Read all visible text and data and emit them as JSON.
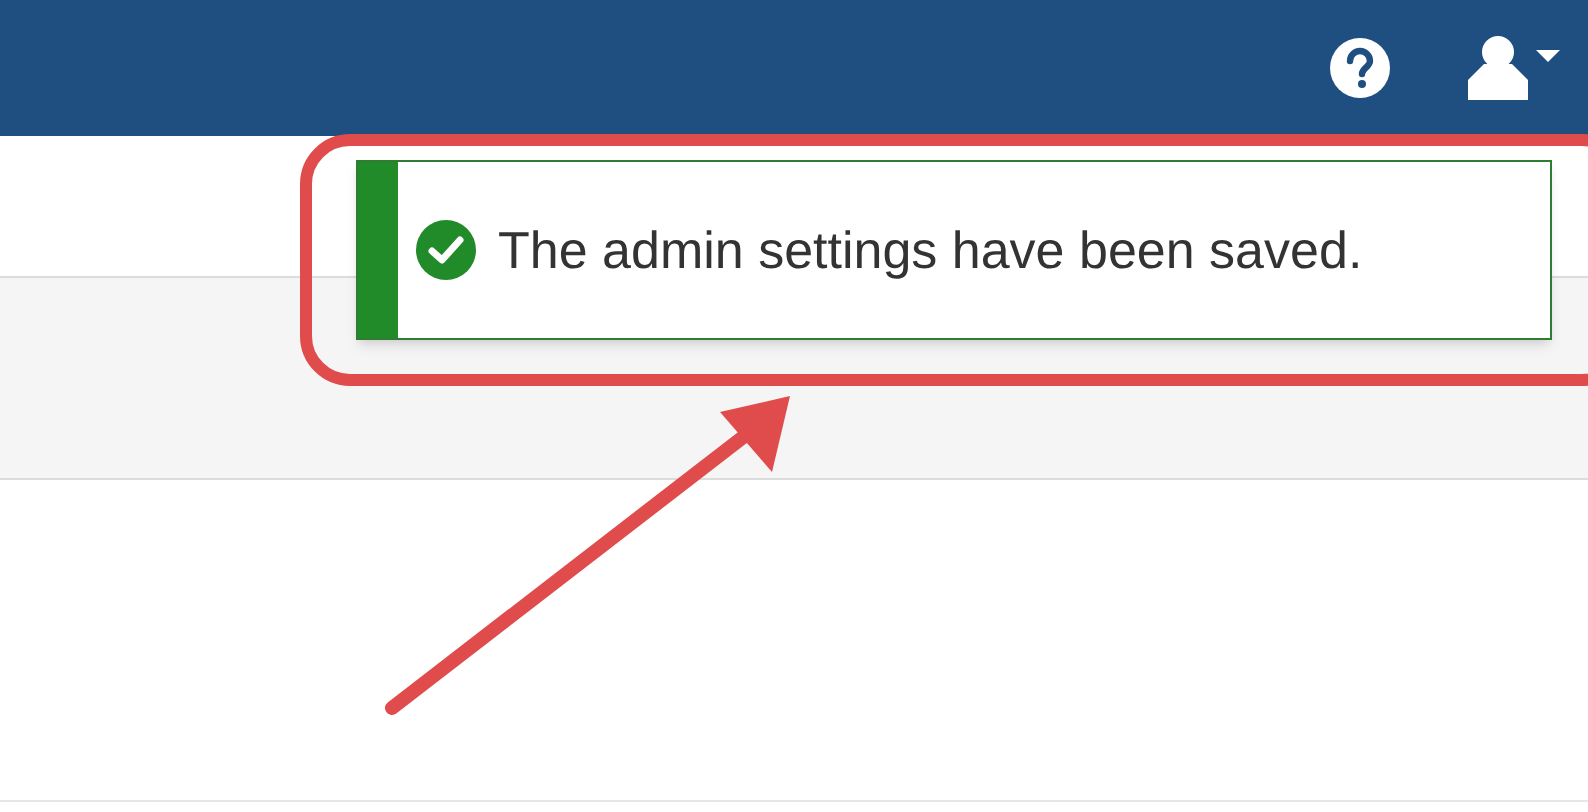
{
  "notification": {
    "kind": "success",
    "message": "The admin settings have been saved."
  }
}
